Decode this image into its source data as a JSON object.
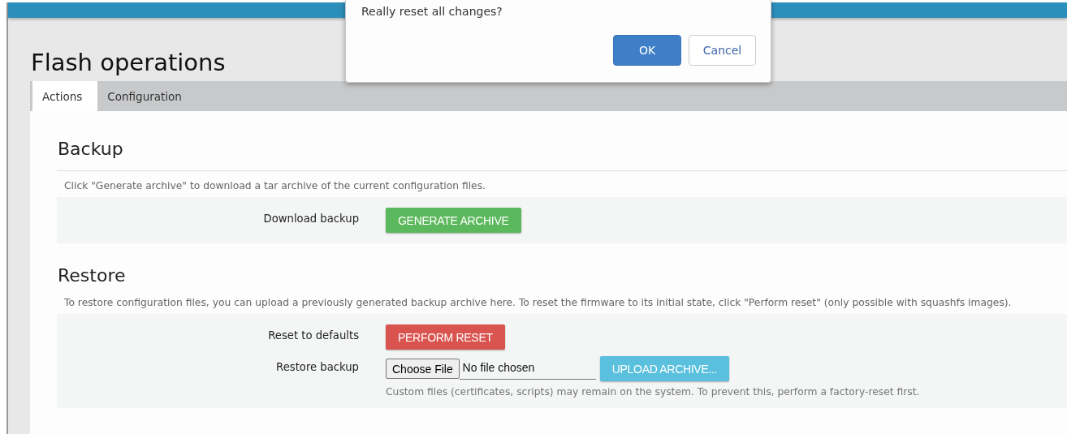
{
  "dialog": {
    "message": "Really reset all changes?",
    "buttons": [
      {
        "label": "OK",
        "kind": "primary"
      },
      {
        "label": "Cancel",
        "kind": "secondary"
      }
    ]
  },
  "page": {
    "title": "Flash operations"
  },
  "tabs": [
    {
      "label": "Actions",
      "selected": true
    },
    {
      "label": "Configuration",
      "selected": false
    }
  ],
  "sections": [
    {
      "heading": "Backup",
      "description": "Click \"Generate archive\" to download a tar archive of the current configuration files.",
      "divider": true,
      "rows": [
        {
          "label": "Download backup",
          "kind": "button",
          "button": {
            "label": "GENERATE ARCHIVE",
            "color": "#5cb85c"
          }
        }
      ]
    },
    {
      "heading": "Restore",
      "description": "To restore configuration files, you can upload a previously generated backup archive here. To reset the firmware to its initial state, click \"Perform reset\" (only possible with squashfs images).",
      "divider": false,
      "rows": [
        {
          "label": "Reset to defaults",
          "kind": "button",
          "button": {
            "label": "PERFORM RESET",
            "color": "#d9534f"
          }
        },
        {
          "label": "Restore backup",
          "kind": "file",
          "choose": "Choose File",
          "status": "No file chosen",
          "button": {
            "label": "UPLOAD ARCHIVE...",
            "color": "#5bc0de"
          },
          "hint": "Custom files (certificates, scripts) may remain on the system. To prevent this, perform a factory-reset first."
        }
      ]
    }
  ]
}
